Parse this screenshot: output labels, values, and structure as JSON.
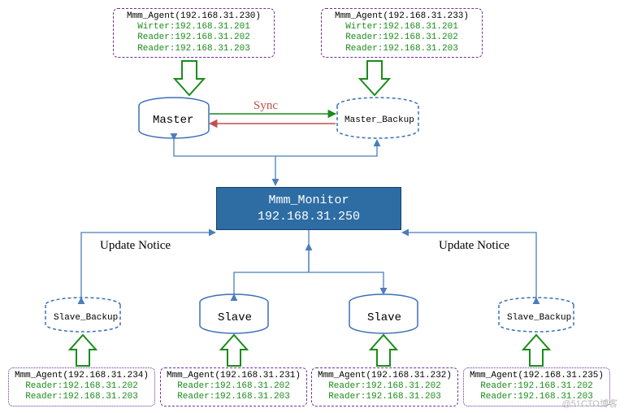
{
  "agents": {
    "top_left": {
      "title": "Mmm_Agent(192.168.31.230)",
      "lines": [
        "Wirter:192.168.31.201",
        "Reader:192.168.31.202",
        "Reader:192.168.31.203"
      ]
    },
    "top_right": {
      "title": "Mmm_Agent(192.168.31.233)",
      "lines": [
        "Wirter:192.168.31.201",
        "Reader:192.168.31.202",
        "Reader:192.168.31.203"
      ]
    },
    "bottom_0": {
      "title": "Mmm_Agent(192.168.31.234)",
      "lines": [
        "Reader:192.168.31.202",
        "Reader:192.168.31.203"
      ]
    },
    "bottom_1": {
      "title": "Mmm_Agent(192.168.31.231)",
      "lines": [
        "Reader:192.168.31.202",
        "Reader:192.168.31.203"
      ]
    },
    "bottom_2": {
      "title": "Mmm_Agent(192.168.31.232)",
      "lines": [
        "Reader:192.168.31.202",
        "Reader:192.168.31.203"
      ]
    },
    "bottom_3": {
      "title": "Mmm_Agent(192.168.31.235)",
      "lines": [
        "Reader:192.168.31.202",
        "Reader:192.168.31.203"
      ]
    }
  },
  "monitor": {
    "name": "Mmm_Monitor",
    "ip": "192.168.31.250"
  },
  "db": {
    "master": "Master",
    "master_backup": "Master_Backup",
    "slave": "Slave",
    "slave_backup": "Slave_Backup"
  },
  "labels": {
    "sync": "Sync",
    "update_notice": "Update Notice"
  },
  "watermark": "@51CTO博客"
}
